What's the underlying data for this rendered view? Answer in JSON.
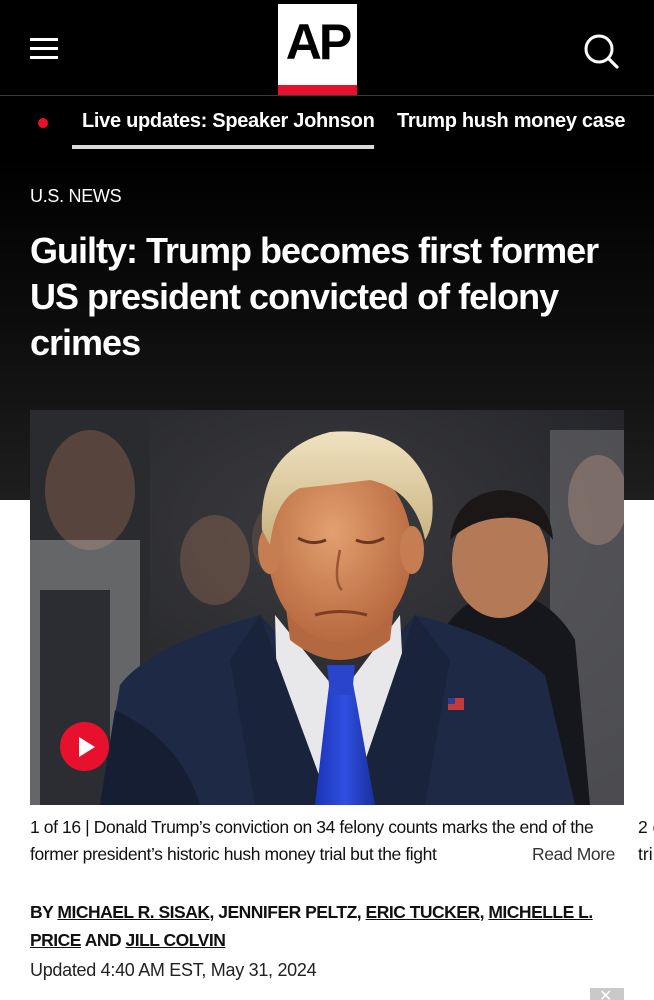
{
  "header": {
    "menu_icon": "hamburger-menu-icon",
    "logo_text": "AP",
    "logo_accent_color": "#e8112d",
    "search_icon": "search-icon"
  },
  "ticker": {
    "live_indicator_color": "#e8112d",
    "items": [
      {
        "label": "Live updates: Speaker Johnson",
        "active": true
      },
      {
        "label": "Trump hush money case",
        "active": false
      }
    ]
  },
  "article": {
    "section": "U.S. NEWS",
    "headline": "Guilty: Trump becomes first former US president convicted of felony crimes",
    "media": {
      "play_icon": "play-icon",
      "caption_counter": "1 of 16 |",
      "caption_text": "Donald Trump’s conviction on 34 felony counts marks the end of the former president’s historic hush money trial but the fight",
      "read_more": "Read More",
      "next_caption_start": "2 o tri"
    },
    "byline": {
      "prefix": "BY",
      "authors": [
        "MICHAEL R. SISAK",
        "JENNIFER PELTZ",
        "ERIC TUCKER",
        "MICHELLE L. PRICE",
        "JILL COLVIN"
      ],
      "separator": ",",
      "conjunction": "AND"
    },
    "updated": "Updated 4:40 AM EST, May 31, 2024"
  },
  "colors": {
    "hero_background": "#000000",
    "accent_red": "#e8112d"
  }
}
